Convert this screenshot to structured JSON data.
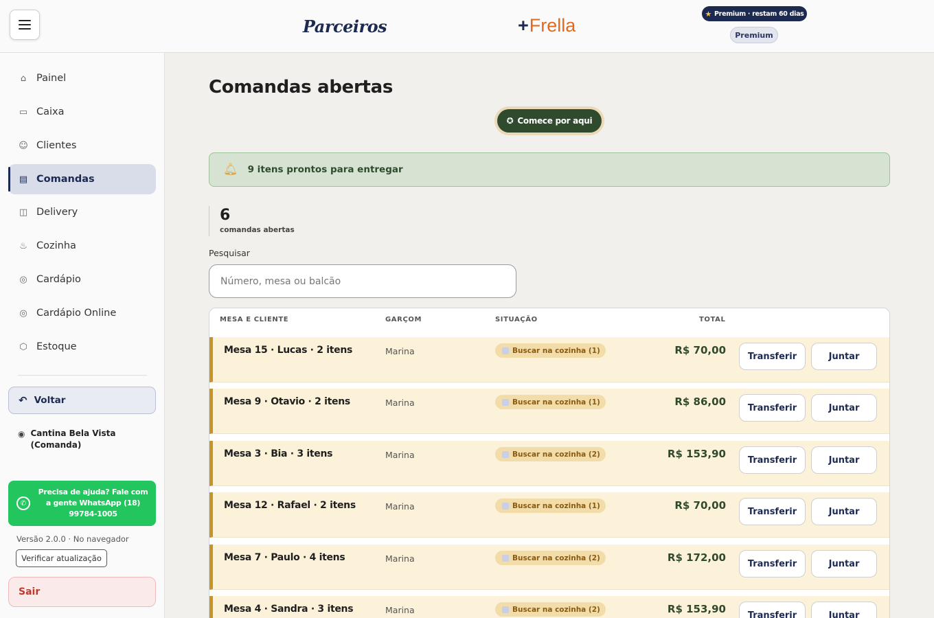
{
  "header": {
    "logo_parceiros": "Parceiros",
    "logo_frella_plus": "+",
    "logo_frella": "Frella",
    "premium_pill": "Premium · restam 60 dias",
    "premium_badge": "Premium"
  },
  "sidebar": {
    "items": [
      {
        "label": "Painel",
        "icon": "home-icon",
        "glyph": "⌂"
      },
      {
        "label": "Caixa",
        "icon": "cash-icon",
        "glyph": "▭"
      },
      {
        "label": "Clientes",
        "icon": "users-icon",
        "glyph": "☺"
      },
      {
        "label": "Comandas",
        "icon": "clipboard-icon",
        "glyph": "▤"
      },
      {
        "label": "Delivery",
        "icon": "bag-icon",
        "glyph": "◫"
      },
      {
        "label": "Cozinha",
        "icon": "cooking-pot-icon",
        "glyph": "♨"
      },
      {
        "label": "Cardápio",
        "icon": "menu-book-icon",
        "glyph": "◎"
      },
      {
        "label": "Cardápio Online",
        "icon": "online-menu-icon",
        "glyph": "◎"
      },
      {
        "label": "Estoque",
        "icon": "box-icon",
        "glyph": "⬡"
      }
    ],
    "voltar": "Voltar",
    "store_name": "Cantina Bela Vista (Comanda)",
    "whatsapp_help": "Precisa de ajuda? Fale com a gente WhatsApp (18) 99784-1005",
    "version": "Versão 2.0.0 · No navegador",
    "update_button": "Verificar atualização",
    "logout": "Sair"
  },
  "main": {
    "title": "Comandas abertas",
    "start_button": "Comece por aqui",
    "alert": "9 itens prontos para entregar",
    "open_count": "6",
    "open_count_label": "comandas abertas",
    "search_label": "Pesquisar",
    "search_placeholder": "Número, mesa ou balcão",
    "table": {
      "headers": [
        "MESA E CLIENTE",
        "GARÇOM",
        "SITUAÇÃO",
        "TOTAL"
      ],
      "transfer_label": "Transferir",
      "join_label": "Juntar",
      "rows": [
        {
          "mesa": "Mesa 15 · Lucas · 2 itens",
          "garcom": "Marina",
          "status": "Buscar na cozinha (1)",
          "total": "R$ 70,00"
        },
        {
          "mesa": "Mesa 9 · Otavio · 2 itens",
          "garcom": "Marina",
          "status": "Buscar na cozinha (1)",
          "total": "R$ 86,00"
        },
        {
          "mesa": "Mesa 3 · Bia · 3 itens",
          "garcom": "Marina",
          "status": "Buscar na cozinha (2)",
          "total": "R$ 153,90"
        },
        {
          "mesa": "Mesa 12 · Rafael · 2 itens",
          "garcom": "Marina",
          "status": "Buscar na cozinha (1)",
          "total": "R$ 70,00"
        },
        {
          "mesa": "Mesa 7 · Paulo · 4 itens",
          "garcom": "Marina",
          "status": "Buscar na cozinha (2)",
          "total": "R$ 172,00"
        },
        {
          "mesa": "Mesa 4 · Sandra · 3 itens",
          "garcom": "Marina",
          "status": "Buscar na cozinha (2)",
          "total": "R$ 153,90"
        }
      ]
    }
  },
  "colors": {
    "brand_navy": "#1c2a52",
    "brand_orange": "#e36a1c",
    "accent_green": "#2f4a2c",
    "row_highlight": "#fcf1d9",
    "row_border": "#c79524",
    "whatsapp": "#22c55e",
    "danger": "#c0392b"
  }
}
